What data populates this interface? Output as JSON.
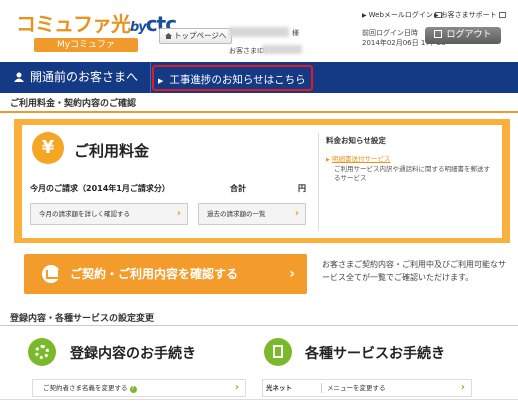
{
  "header": {
    "logo_main": "コミュファ光",
    "logo_by": "by",
    "logo_ctc": "ctc",
    "logo_sub": "Myコミュファ",
    "top_page_button": "トップページへ",
    "honorific": "様",
    "customer_id_label": "お客さまID：",
    "webmail_login": "Webメールログイン",
    "support_link": "お客さまサポート",
    "last_login_label": "前回ログイン日時",
    "last_login_value": "2014年02月06日 17：28",
    "logout_button": "ログアウト"
  },
  "nav": {
    "item1": "開通前のお客さまへ",
    "item2": "工事進捗のお知らせはこちら"
  },
  "section1": {
    "title": "ご利用料金・契約内容のご確認"
  },
  "billing": {
    "icon_symbol": "¥",
    "title": "ご利用料金",
    "current_bill_label": "今月のご請求（2014年1月ご請求分）",
    "total_label": "合計",
    "yen_unit": "円",
    "detail_button": "今月の請求額を詳しく確認する",
    "history_button": "過去の請求額の一覧",
    "notice_title": "料金お知らせ設定",
    "notice_link": "明細書送付サービス",
    "notice_desc": "ご利用サービス内訳や通話料に関する明細書を郵送するサービス"
  },
  "contract": {
    "button_label": "ご契約・ご利用内容を確認する",
    "description": "お客さまご契約内容・ご利用中及びご利用可能なサービス全てが一覧でご確認いただけます。"
  },
  "section2": {
    "title": "登録内容・各種サービスの設定変更",
    "registration_title": "登録内容のお手続き",
    "services_title": "各種サービスお手続き",
    "name_change_link": "ご契約者さま名義を変更する",
    "question_mark": "?",
    "hikari_net_label": "光ネット",
    "menu_change_link": "メニューを変更する"
  },
  "colors": {
    "brand_orange": "#f19a2c",
    "panel_orange": "#fbb03b",
    "nav_blue": "#153a85",
    "highlight_red": "#e11b22",
    "accent_green": "#7ab929"
  }
}
